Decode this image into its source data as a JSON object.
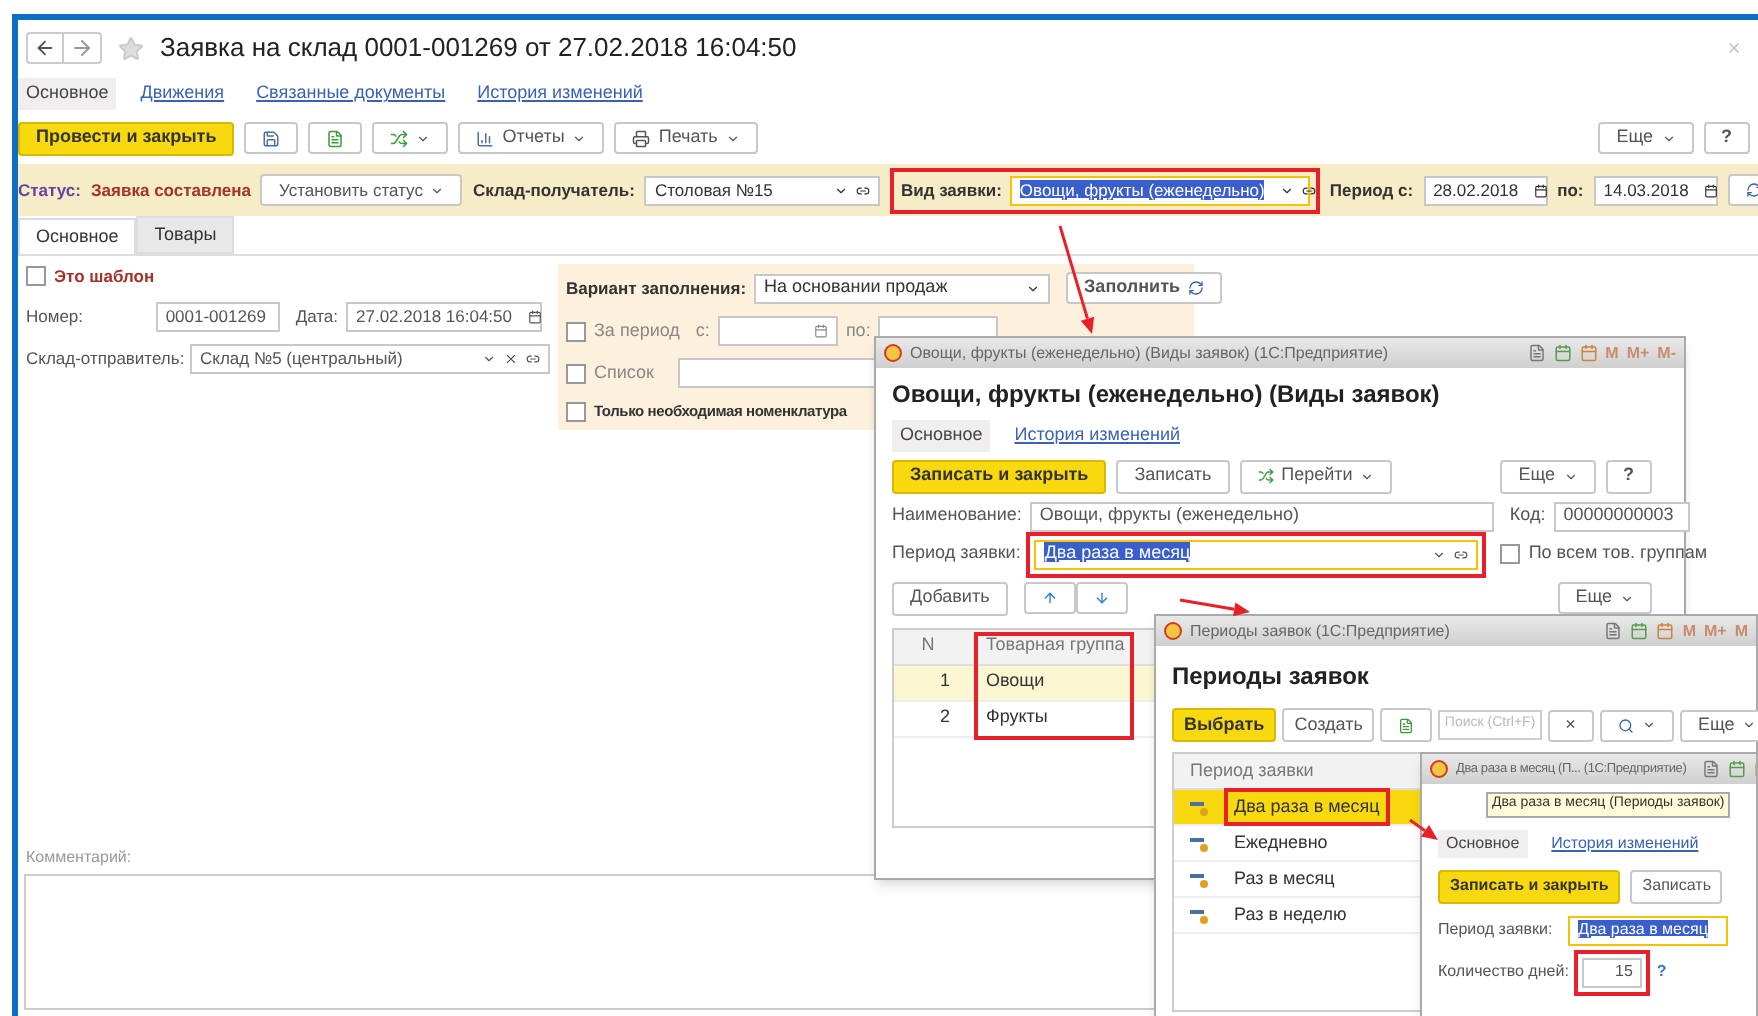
{
  "window": {
    "title": "Заявка на склад 0001-001269 от 27.02.2018 16:04:50"
  },
  "tabs": [
    {
      "label": "Основное",
      "selected": true
    },
    {
      "label": "Движения",
      "selected": false
    },
    {
      "label": "Связанные документы",
      "selected": false
    },
    {
      "label": "История изменений",
      "selected": false
    }
  ],
  "toolbar": {
    "primary": "Провести и закрыть",
    "reports": "Отчеты",
    "print": "Печать",
    "more": "Еще",
    "help": "?"
  },
  "status_bar": {
    "label": "Статус:",
    "value": "Заявка составлена",
    "set_status": "Установить статус",
    "recipient_label": "Склад-получатель:",
    "recipient": "Столовая №15",
    "kind_label": "Вид заявки:",
    "kind": "Овощи, фрукты (еженедельно)",
    "from_label": "Период с:",
    "from": "28.02.2018",
    "to_label": "по:",
    "to": "14.03.2018"
  },
  "form_tabs": [
    {
      "label": "Основное",
      "selected": true
    },
    {
      "label": "Товары",
      "selected": false
    }
  ],
  "form": {
    "template": {
      "label": "Это шаблон",
      "checked": false
    },
    "number_label": "Номер:",
    "number": "0001-001269",
    "date_label": "Дата:",
    "date": "27.02.2018 16:04:50",
    "sender_label": "Склад-отправитель:",
    "sender": "Склад №5 (центральный)",
    "comment_label": "Комментарий:"
  },
  "fill_panel": {
    "variant_label": "Вариант заполнения:",
    "variant": "На основании продаж",
    "fill_button": "Заполнить",
    "period": {
      "label": "За период",
      "checked": false
    },
    "from_label": "с:",
    "to_label": "по:",
    "list": {
      "label": "Список",
      "checked": false
    },
    "only_needed": {
      "label": "Только необходимая номенклатура",
      "checked": false
    }
  },
  "kind_window": {
    "title": "Овощи, фрукты (еженедельно) (Виды заявок) (1С:Предприятие)",
    "memory_buttons": [
      "M",
      "M+",
      "M-"
    ],
    "heading": "Овощи, фрукты (еженедельно) (Виды заявок)",
    "tabs": [
      {
        "label": "Основное",
        "selected": true
      },
      {
        "label": "История изменений",
        "selected": false
      }
    ],
    "save_close": "Записать и закрыть",
    "save": "Записать",
    "goto": "Перейти",
    "more": "Еще",
    "help": "?",
    "name_label": "Наименование:",
    "name": "Овощи, фрукты (еженедельно)",
    "code_label": "Код:",
    "code": "00000000003",
    "period_label": "Период заявки:",
    "period": "Два раза в месяц",
    "all_groups": {
      "label": "По всем тов. группам",
      "checked": false
    },
    "add": "Добавить",
    "more2": "Еще",
    "columns": [
      "N",
      "Товарная группа"
    ],
    "rows": [
      {
        "n": "1",
        "group": "Овощи",
        "selected": true
      },
      {
        "n": "2",
        "group": "Фрукты",
        "selected": false
      }
    ]
  },
  "periods_window": {
    "title": "Периоды заявок (1С:Предприятие)",
    "memory_buttons": [
      "M",
      "M+",
      "M"
    ],
    "heading": "Периоды заявок",
    "select": "Выбрать",
    "create": "Создать",
    "search": {
      "placeholder": "Поиск (Ctrl+F)"
    },
    "clear": "×",
    "more": "Еще",
    "column": "Период заявки",
    "rows": [
      {
        "label": "Два раза в месяц",
        "selected": true
      },
      {
        "label": "Ежедневно",
        "selected": false
      },
      {
        "label": "Раз в месяц",
        "selected": false
      },
      {
        "label": "Раз в неделю",
        "selected": false
      }
    ]
  },
  "period_window": {
    "title": "Два раза в месяц (П... (1С:Предприятие)",
    "tooltip": "Два раза в месяц (Периоды заявок)",
    "tabs": [
      {
        "label": "Основное",
        "selected": true
      },
      {
        "label": "История изменений",
        "selected": false
      }
    ],
    "save_close": "Записать и закрыть",
    "save": "Записать",
    "period_label": "Период заявки:",
    "period": "Два раза в месяц",
    "days_label": "Количество дней:",
    "days": "15",
    "help": "?"
  }
}
